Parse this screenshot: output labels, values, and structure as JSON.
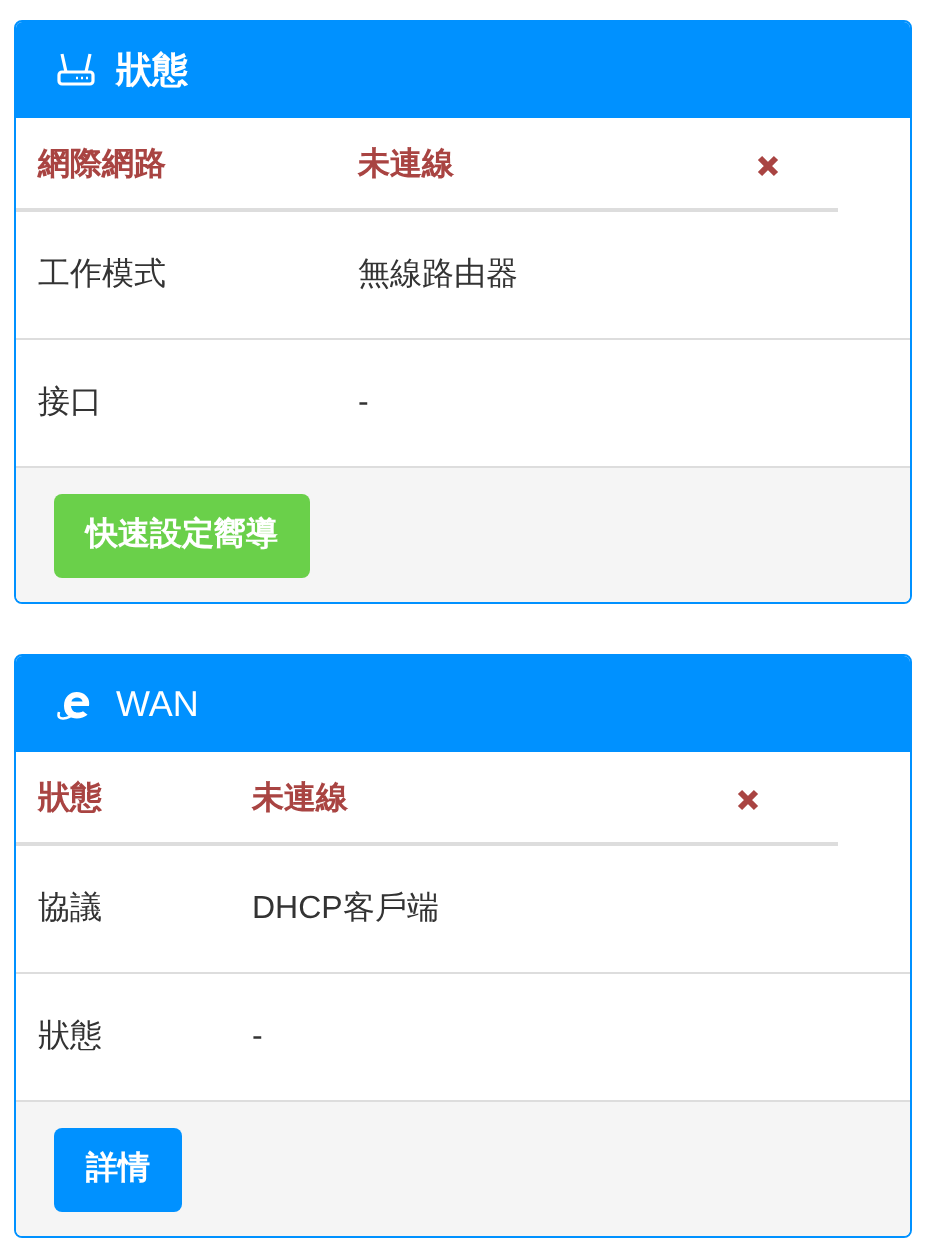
{
  "panels": [
    {
      "title": "狀態",
      "rows": [
        {
          "kind": "status",
          "label": "網際網路",
          "value": "未連線",
          "connected": false
        },
        {
          "kind": "info",
          "label": "工作模式",
          "value": "無線路由器"
        },
        {
          "kind": "info",
          "label": "接口",
          "value": "-"
        }
      ],
      "button": {
        "label": "快速設定嚮導"
      }
    },
    {
      "title": "WAN",
      "rows": [
        {
          "kind": "status",
          "label": "狀態",
          "value": "未連線",
          "connected": false
        },
        {
          "kind": "info",
          "label": "協議",
          "value": "DHCP客戶端"
        },
        {
          "kind": "info",
          "label": "狀態",
          "value": "-"
        }
      ],
      "button": {
        "label": "詳情"
      }
    }
  ]
}
